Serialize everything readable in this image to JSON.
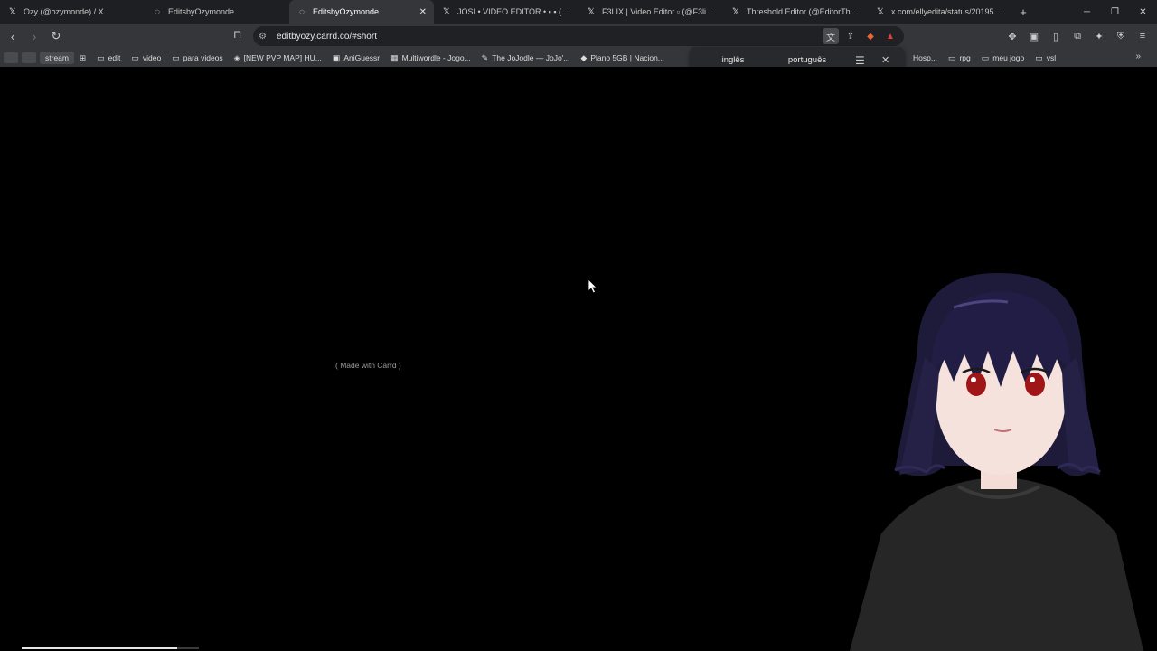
{
  "tabs": [
    {
      "favicon": "x-icon",
      "glyph": "𝕏",
      "title": "Ozy (@ozymonde) / X",
      "active": false
    },
    {
      "favicon": "globe-icon",
      "glyph": "◌",
      "title": "EditsbyOzymonde",
      "active": false
    },
    {
      "favicon": "globe-icon",
      "glyph": "◌",
      "title": "EditsbyOzymonde",
      "active": true
    },
    {
      "favicon": "x-icon",
      "glyph": "𝕏",
      "title": "JOSI • VIDEO EDITOR • ▪ ▪ (@Josi",
      "active": false
    },
    {
      "favicon": "x-icon",
      "glyph": "𝕏",
      "title": "F3LIX | Video Editor ▫ (@F3lix__Edit",
      "active": false
    },
    {
      "favicon": "x-icon",
      "glyph": "𝕏",
      "title": "Threshold Editor (@EditorThreshold",
      "active": false
    },
    {
      "favicon": "x-icon",
      "glyph": "𝕏",
      "title": "x.com/ellyedita/status/201953968361",
      "active": false
    }
  ],
  "toolbar": {
    "url": "editbyozy.carrd.co/#short"
  },
  "bookmarks": {
    "left": [
      {
        "icon": "folder-icon",
        "glyph": "▭",
        "label": "edit"
      },
      {
        "icon": "folder-icon",
        "glyph": "▭",
        "label": "video"
      },
      {
        "icon": "folder-icon",
        "glyph": "▭",
        "label": "para videos"
      },
      {
        "icon": "map-icon",
        "glyph": "◈",
        "label": "[NEW PVP MAP] HU..."
      },
      {
        "icon": "anime-icon",
        "glyph": "▣",
        "label": "AniGuessr"
      },
      {
        "icon": "wordle-icon",
        "glyph": "▦",
        "label": "Multiwordle - Jogo..."
      },
      {
        "icon": "feather-icon",
        "glyph": "✎",
        "label": "The JoJodle — JoJo'..."
      },
      {
        "icon": "tag-icon",
        "glyph": "◆",
        "label": "Plano 5GB | Nacion..."
      }
    ],
    "stream_label": "stream",
    "right": [
      {
        "icon": "bookmark-icon",
        "glyph": "",
        "label": "Hosp..."
      },
      {
        "icon": "folder-icon",
        "glyph": "▭",
        "label": "rpg"
      },
      {
        "icon": "folder-icon",
        "glyph": "▭",
        "label": "meu jogo"
      },
      {
        "icon": "folder-icon",
        "glyph": "▭",
        "label": "vsl"
      }
    ]
  },
  "translate_popup": {
    "languages": [
      "inglês",
      "português"
    ],
    "selected": "inglês"
  },
  "page": {
    "footer_text": "( Made with Carrd )"
  },
  "video_progress": 0.88,
  "colors": {
    "page_background": "#000000",
    "toolbar": "#35363a",
    "tabstrip": "#1e1f22",
    "accent": "#8ab4f8"
  }
}
